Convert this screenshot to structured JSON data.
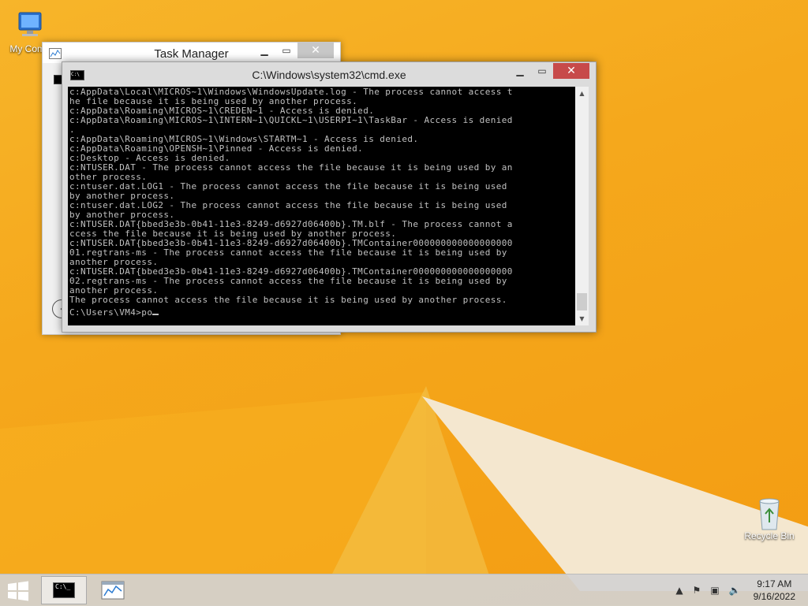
{
  "desktop": {
    "icons": [
      {
        "label": "My Comp"
      },
      {
        "label": "Recycle Bin"
      }
    ]
  },
  "task_manager": {
    "title": "Task Manager"
  },
  "cmd": {
    "title": "C:\\Windows\\system32\\cmd.exe",
    "lines": [
      "c:AppData\\Local\\MICROS~1\\Windows\\WindowsUpdate.log - The process cannot access t",
      "he file because it is being used by another process.",
      "c:AppData\\Roaming\\MICROS~1\\CREDEN~1 - Access is denied.",
      "c:AppData\\Roaming\\MICROS~1\\INTERN~1\\QUICKL~1\\USERPI~1\\TaskBar - Access is denied",
      ".",
      "c:AppData\\Roaming\\MICROS~1\\Windows\\STARTM~1 - Access is denied.",
      "c:AppData\\Roaming\\OPENSH~1\\Pinned - Access is denied.",
      "c:Desktop - Access is denied.",
      "c:NTUSER.DAT - The process cannot access the file because it is being used by an",
      "other process.",
      "c:ntuser.dat.LOG1 - The process cannot access the file because it is being used",
      "by another process.",
      "c:ntuser.dat.LOG2 - The process cannot access the file because it is being used",
      "by another process.",
      "c:NTUSER.DAT{bbed3e3b-0b41-11e3-8249-d6927d06400b}.TM.blf - The process cannot a",
      "ccess the file because it is being used by another process.",
      "c:NTUSER.DAT{bbed3e3b-0b41-11e3-8249-d6927d06400b}.TMContainer000000000000000000",
      "01.regtrans-ms - The process cannot access the file because it is being used by",
      "another process.",
      "c:NTUSER.DAT{bbed3e3b-0b41-11e3-8249-d6927d06400b}.TMContainer000000000000000000",
      "02.regtrans-ms - The process cannot access the file because it is being used by",
      "another process.",
      "The process cannot access the file because it is being used by another process.",
      ""
    ],
    "prompt": "C:\\Users\\VM4>po"
  },
  "taskbar": {
    "time": "9:17 AM",
    "date": "9/16/2022"
  }
}
